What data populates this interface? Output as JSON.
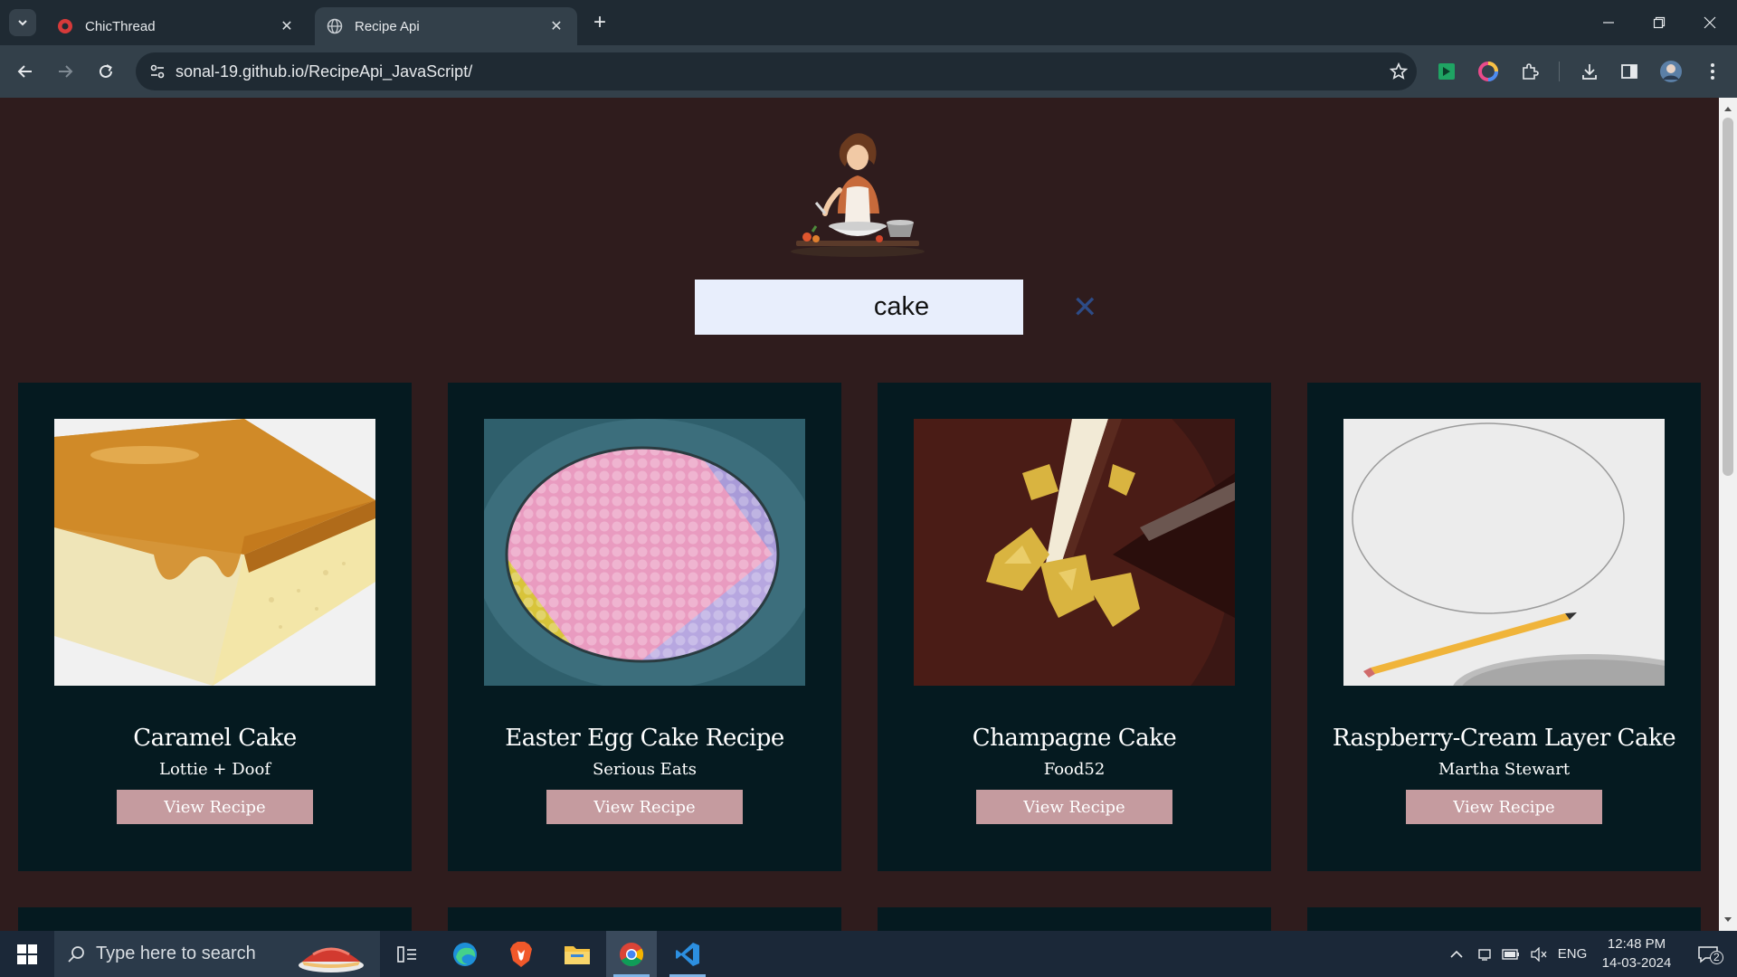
{
  "browser": {
    "tabs": [
      {
        "title": "ChicThread",
        "active": false
      },
      {
        "title": "Recipe Api",
        "active": true
      }
    ],
    "url": "sonal-19.github.io/RecipeApi_JavaScript/"
  },
  "search": {
    "value": "cake",
    "clear_symbol": "✕"
  },
  "recipes": [
    {
      "title": "Caramel Cake",
      "source": "Lottie + Doof",
      "button": "View Recipe"
    },
    {
      "title": "Easter Egg Cake Recipe",
      "source": "Serious Eats",
      "button": "View Recipe"
    },
    {
      "title": "Champagne Cake",
      "source": "Food52",
      "button": "View Recipe"
    },
    {
      "title": "Raspberry-Cream Layer Cake",
      "source": "Martha Stewart",
      "button": "View Recipe"
    }
  ],
  "taskbar": {
    "search_placeholder": "Type here to search",
    "language": "ENG",
    "time": "12:48 PM",
    "date": "14-03-2024",
    "notifications": "2"
  },
  "colors": {
    "page_bg": "#2f1c1d",
    "card_bg": "#051a20",
    "button_bg": "#c59b9f",
    "search_bg": "#e8eefc"
  }
}
